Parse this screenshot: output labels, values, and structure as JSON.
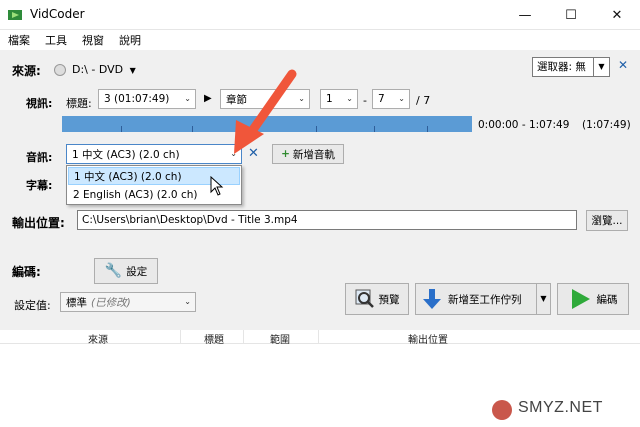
{
  "window": {
    "title": "VidCoder",
    "minimize": "—",
    "maximize": "☐",
    "close": "✕"
  },
  "menu": [
    "檔案",
    "工具",
    "視窗",
    "說明"
  ],
  "source": {
    "label": "來源:",
    "drive": "D:\\ - DVD",
    "picker_label": "選取器: 無",
    "pin": "📌"
  },
  "video": {
    "label": "視訊:",
    "title_label": "標題:",
    "title_value": "3 (01:07:49)",
    "chapter_mode": "章節",
    "chapter_start": "1",
    "chapter_end": "7",
    "dash": "-",
    "chapter_total": "/ 7",
    "time_range": "0:00:00 - 1:07:49",
    "duration": "(1:07:49)"
  },
  "audio": {
    "label": "音訊:",
    "selected": "1 中文 (AC3) (2.0 ch)",
    "add_label": "新增音軌",
    "options": [
      "1 中文 (AC3) (2.0 ch)",
      "2 English (AC3) (2.0 ch)"
    ]
  },
  "subtitles": {
    "label": "字幕:"
  },
  "output": {
    "label": "輸出位置:",
    "path": "C:\\Users\\brian\\Desktop\\Dvd - Title 3.mp4",
    "browse": "瀏覽..."
  },
  "encoding": {
    "label": "編碼:",
    "settings_button": "設定",
    "preset_label": "設定值:",
    "preset_value": "標準",
    "preset_modified": "(已修改)",
    "preview_button": "預覽",
    "add_queue_button": "新增至工作佇列",
    "encode_button": "編碼"
  },
  "queue_table": {
    "columns": [
      "來源",
      "標題",
      "範圍",
      "輸出位置"
    ]
  },
  "watermark": "SMYZ.NET"
}
